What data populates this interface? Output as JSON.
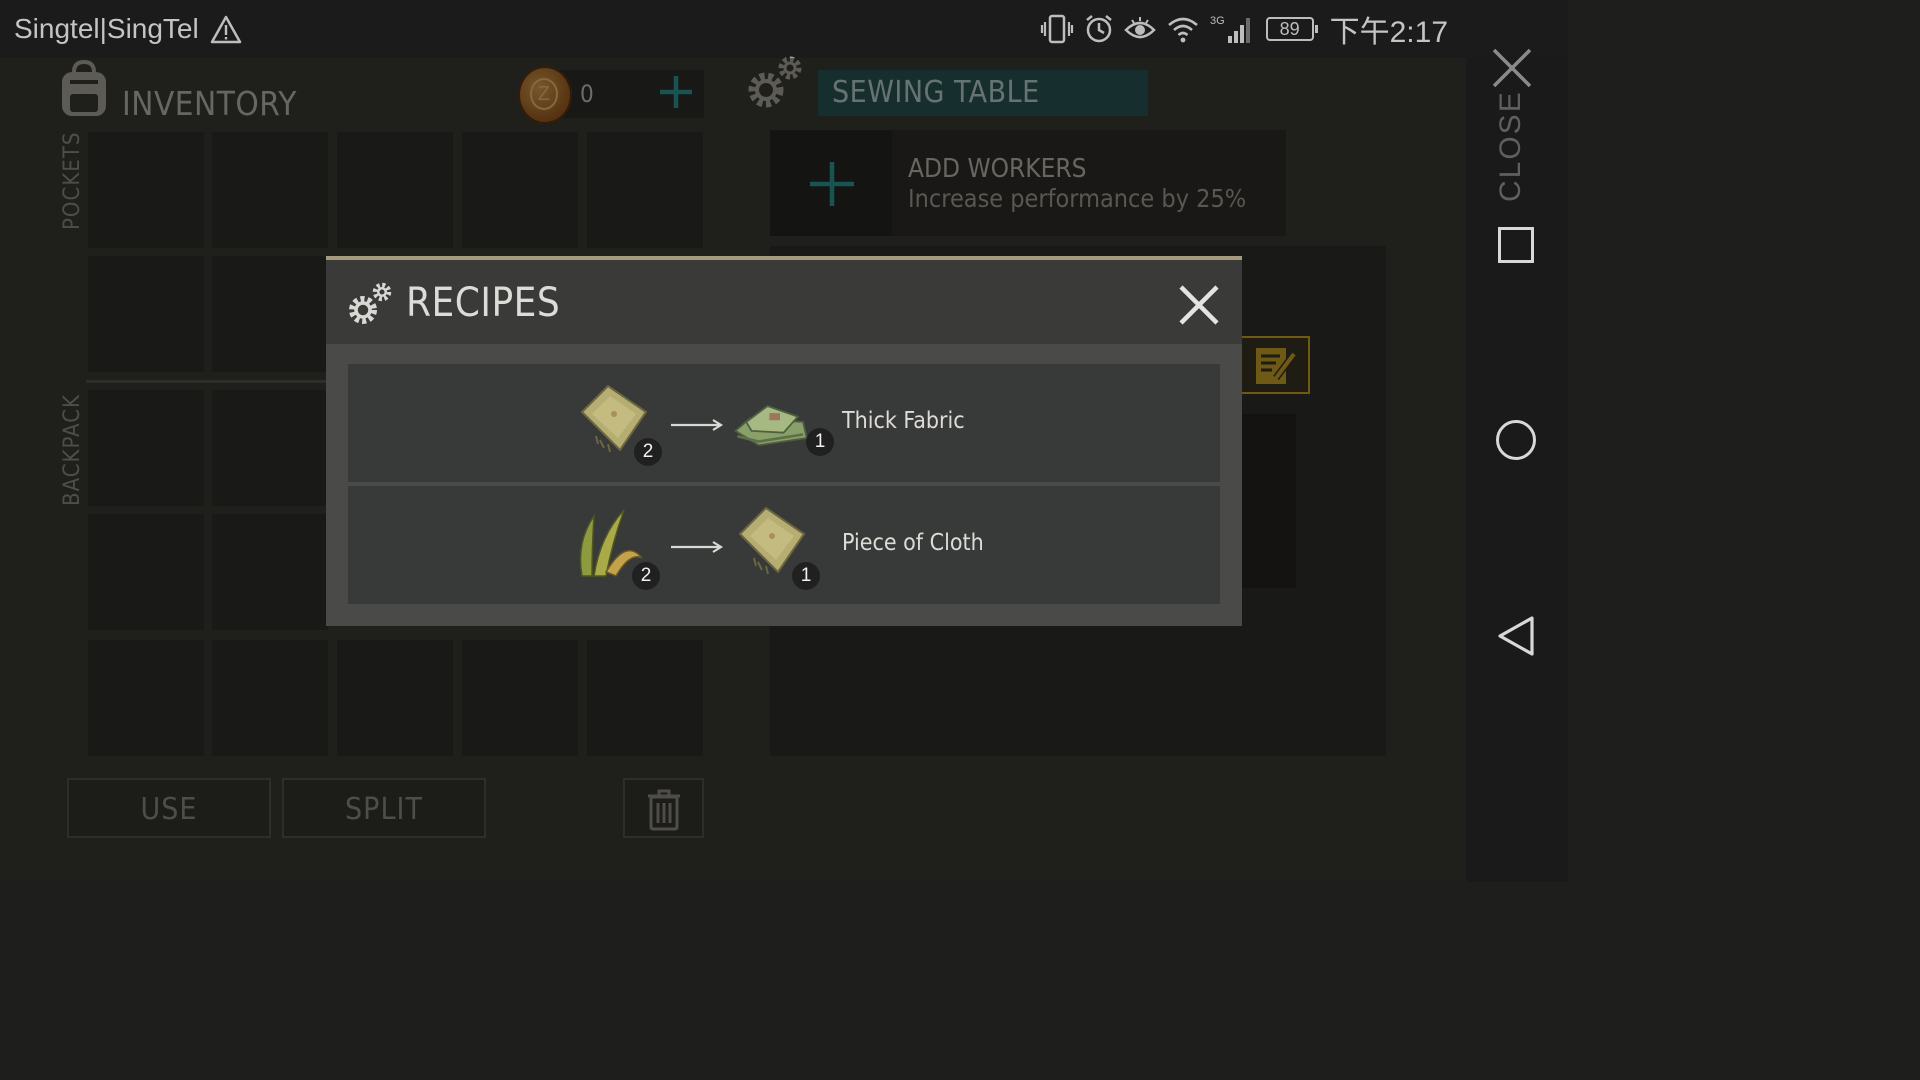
{
  "status_bar": {
    "carrier": "Singtel|SingTel",
    "network": "3G",
    "battery": "89",
    "time": "下午2:17",
    "icons": [
      "warning-icon",
      "vibrate-icon",
      "alarm-icon",
      "eye-comfort-icon",
      "wifi-icon",
      "signal-icon",
      "battery-icon"
    ]
  },
  "inventory": {
    "title": "INVENTORY",
    "currency_value": "0",
    "pockets_label": "POCKETS",
    "backpack_label": "BACKPACK",
    "use_label": "USE",
    "split_label": "SPLIT"
  },
  "workbench": {
    "title": "SEWING TABLE",
    "add_workers_title": "ADD WORKERS",
    "add_workers_sub": "Increase performance by 25%"
  },
  "nav": {
    "close_label": "CLOSE"
  },
  "modal": {
    "title": "RECIPES",
    "recipes": [
      {
        "input_icon": "cloth-piece-icon",
        "input_count": "2",
        "output_icon": "thick-fabric-icon",
        "output_count": "1",
        "name": "Thick Fabric"
      },
      {
        "input_icon": "plant-fiber-icon",
        "input_count": "2",
        "output_icon": "cloth-piece-icon",
        "output_count": "1",
        "name": "Piece of Cloth"
      }
    ]
  },
  "colors": {
    "accent_teal": "#2b5554",
    "plus_teal": "#2a9a96",
    "note_gold": "#c9a227",
    "modal_border": "#a69a7e"
  }
}
